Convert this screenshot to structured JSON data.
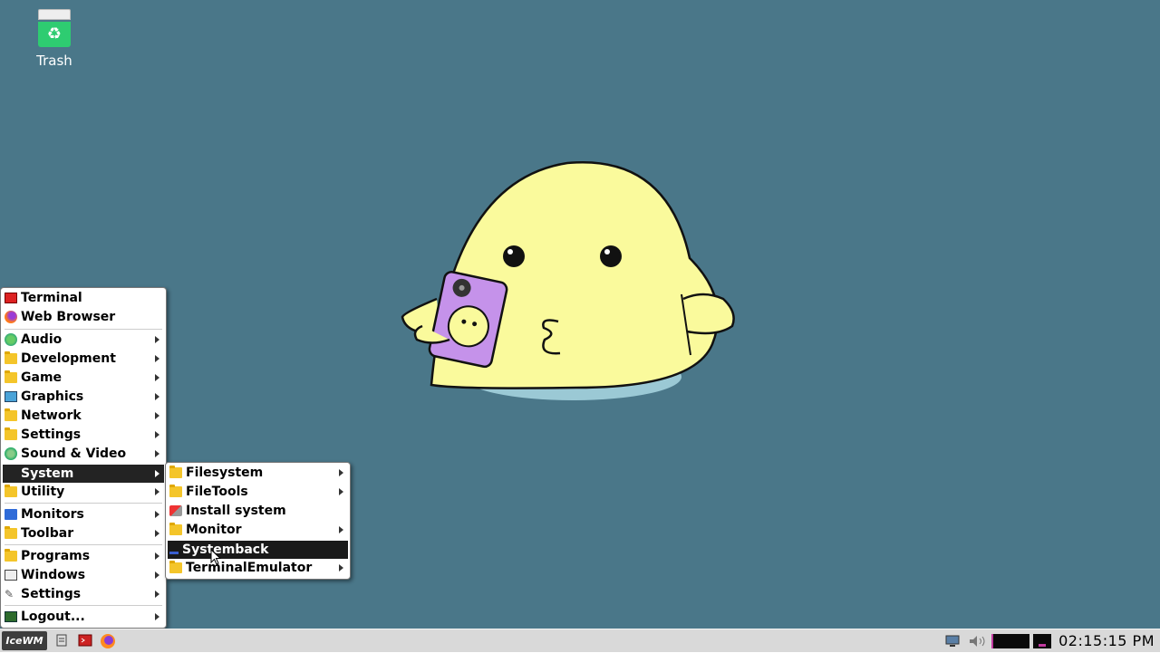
{
  "desktop": {
    "background_color": "#4a7789",
    "icons": [
      {
        "label": "Trash",
        "icon": "trash-icon"
      }
    ]
  },
  "start_menu": {
    "items": [
      {
        "label": "Terminal",
        "icon": "terminal-icon",
        "submenu": false
      },
      {
        "label": "Web Browser",
        "icon": "firefox-icon",
        "submenu": false
      },
      {
        "label": "Audio",
        "icon": "audio-icon",
        "submenu": true
      },
      {
        "label": "Development",
        "icon": "folder-icon",
        "submenu": true
      },
      {
        "label": "Game",
        "icon": "folder-icon",
        "submenu": true
      },
      {
        "label": "Graphics",
        "icon": "graphics-icon",
        "submenu": true
      },
      {
        "label": "Network",
        "icon": "folder-icon",
        "submenu": true
      },
      {
        "label": "Settings",
        "icon": "folder-icon",
        "submenu": true
      },
      {
        "label": "Sound & Video",
        "icon": "sound-video-icon",
        "submenu": true
      },
      {
        "label": "System",
        "icon": "none",
        "submenu": true,
        "active": true
      },
      {
        "label": "Utility",
        "icon": "folder-icon",
        "submenu": true
      },
      {
        "label": "Monitors",
        "icon": "monitor-icon",
        "submenu": true
      },
      {
        "label": "Toolbar",
        "icon": "folder-icon",
        "submenu": true
      },
      {
        "label": "Programs",
        "icon": "programs-icon",
        "submenu": true
      },
      {
        "label": "Windows",
        "icon": "windows-icon",
        "submenu": true
      },
      {
        "label": "Settings",
        "icon": "settings-icon",
        "submenu": true
      },
      {
        "label": "Logout...",
        "icon": "logout-icon",
        "submenu": true
      }
    ]
  },
  "system_submenu": {
    "items": [
      {
        "label": "Filesystem",
        "icon": "folder-icon",
        "submenu": true
      },
      {
        "label": "FileTools",
        "icon": "folder-icon",
        "submenu": true
      },
      {
        "label": "Install system",
        "icon": "install-icon",
        "submenu": false
      },
      {
        "label": "Monitor",
        "icon": "folder-icon",
        "submenu": true
      },
      {
        "label": "Systemback",
        "icon": "systemback-icon",
        "submenu": false,
        "hover": true
      },
      {
        "label": "TerminalEmulator",
        "icon": "folder-icon",
        "submenu": true
      }
    ]
  },
  "taskbar": {
    "start_label": "IceWM",
    "clock": "02:15:15 PM",
    "quick_launch": [
      "file-manager-icon",
      "terminal-icon",
      "firefox-icon"
    ],
    "tray": [
      "network-icon",
      "volume-icon",
      "cpu-monitor-icon",
      "workspace-icon"
    ]
  }
}
